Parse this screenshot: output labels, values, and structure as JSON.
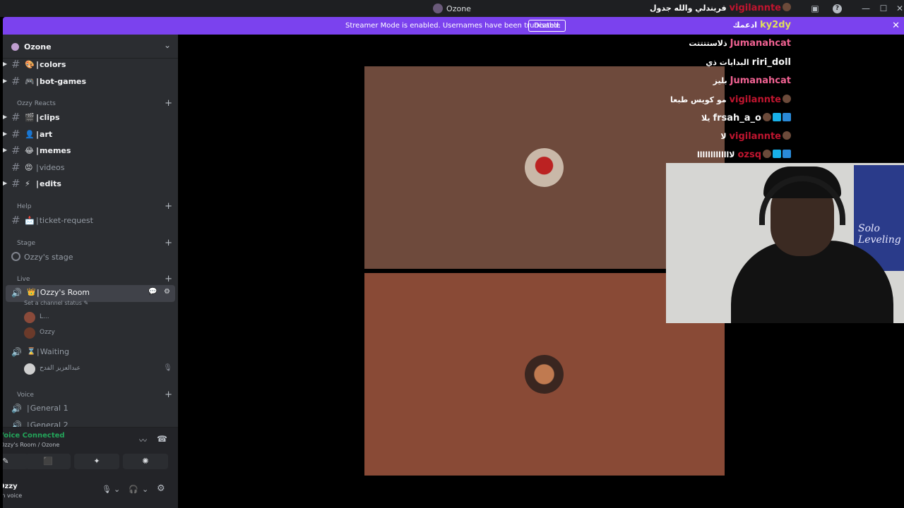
{
  "window": {
    "title": "Ozone",
    "minimize": "—",
    "maximize": "☐",
    "close": "✕",
    "inbox_icon": "▣",
    "help_icon": "?"
  },
  "banner": {
    "message": "Streamer Mode is enabled. Usernames have been truncated.",
    "button": "Disable",
    "close": "✕",
    "color": "#7b42ee"
  },
  "server": {
    "name": "Ozone",
    "chevron": "⌄"
  },
  "channels_top": [
    {
      "emoji": "🎨",
      "label": "colors"
    },
    {
      "emoji": "🎮",
      "label": "bot-games"
    }
  ],
  "category_reacts": {
    "label": "Ozzy Reacts",
    "plus": "+"
  },
  "channels_reacts": [
    {
      "emoji": "🎬",
      "label": "clips",
      "muted": false
    },
    {
      "emoji": "👤",
      "label": "art",
      "muted": false
    },
    {
      "emoji": "😂",
      "label": "memes",
      "muted": false
    },
    {
      "emoji": "😡",
      "label": "videos",
      "muted": true
    },
    {
      "emoji": "⚡",
      "label": "edits",
      "muted": false
    }
  ],
  "category_help": {
    "label": "Help",
    "plus": "+"
  },
  "channel_ticket": {
    "emoji": "📩",
    "label": "ticket-request"
  },
  "category_stage": {
    "label": "Stage",
    "plus": "+"
  },
  "stage_channel": {
    "label": "Ozzy's stage"
  },
  "category_live": {
    "label": "Live",
    "plus": "+"
  },
  "voice_active": {
    "emoji": "👑",
    "label": "Ozzy's Room",
    "status": "Set a channel status ✎",
    "actions": "💬 ⚙"
  },
  "members_room": [
    {
      "name": "L...",
      "color": "#8a4a3a"
    },
    {
      "name": "Ozzy",
      "color": "#6b3a2a"
    }
  ],
  "voice_waiting": {
    "emoji": "⌛",
    "label": "Waiting"
  },
  "member_waiting": {
    "name": "عبدالعزيز الفدح",
    "color": "#cfcfcf",
    "mic": "🎙"
  },
  "category_voice": {
    "label": "Voice",
    "plus": "+"
  },
  "voice_general": [
    {
      "label": "General 1"
    },
    {
      "label": "General 2"
    }
  ],
  "voice_panel": {
    "connected": "Voice Connected",
    "location": "Ozzy's Room / Ozone",
    "noise_icon": "〰",
    "disconnect_icon": "☎",
    "buttons": [
      "✎",
      "⬛",
      "✦",
      "✺"
    ]
  },
  "user": {
    "name": "Ozzy",
    "status": "In voice",
    "mic": "🎙",
    "headset": "🎧",
    "settings": "⚙",
    "caret": "⌄"
  },
  "tiles": [
    {
      "bg": "#6e4a3c",
      "avatar": "#7a2a22"
    },
    {
      "bg": "#894a36",
      "avatar": "#5a3a30"
    }
  ],
  "chat": [
    {
      "msg": "فريندلي والله جدول",
      "user": "vigilannte",
      "color": "#c0152f",
      "avatar": true,
      "badges": []
    },
    {
      "msg": "ادعمك",
      "user": "ky2dy",
      "color": "#e0e05a",
      "avatar": false,
      "badges": []
    },
    {
      "msg": "ذلاستتتتت",
      "user": "Jumanahcat",
      "color": "#f06292",
      "avatar": false,
      "badges": []
    },
    {
      "msg": "البدايات ذي",
      "user": "riri_doll",
      "color": "#f5f5f5",
      "avatar": false,
      "badges": []
    },
    {
      "msg": "بليز",
      "user": "Jumanahcat",
      "color": "#f06292",
      "avatar": false,
      "badges": []
    },
    {
      "msg": "مو كويس طبعا",
      "user": "vigilannte",
      "color": "#c0152f",
      "avatar": true,
      "badges": []
    },
    {
      "msg": "يلا",
      "user": "frsah_a_o",
      "color": "#f5f5f5",
      "avatar": true,
      "badges": [
        "#2a8ad8",
        "#18b0e8"
      ]
    },
    {
      "msg": "لا",
      "user": "vigilannte",
      "color": "#c0152f",
      "avatar": true,
      "badges": []
    },
    {
      "msg": "لااااااااااااا",
      "user": "ozsq",
      "color": "#c0152f",
      "avatar": true,
      "badges": [
        "#2a8ad8",
        "#18b0e8"
      ]
    }
  ],
  "webcam": {
    "poster_text": "Solo Leveling"
  }
}
